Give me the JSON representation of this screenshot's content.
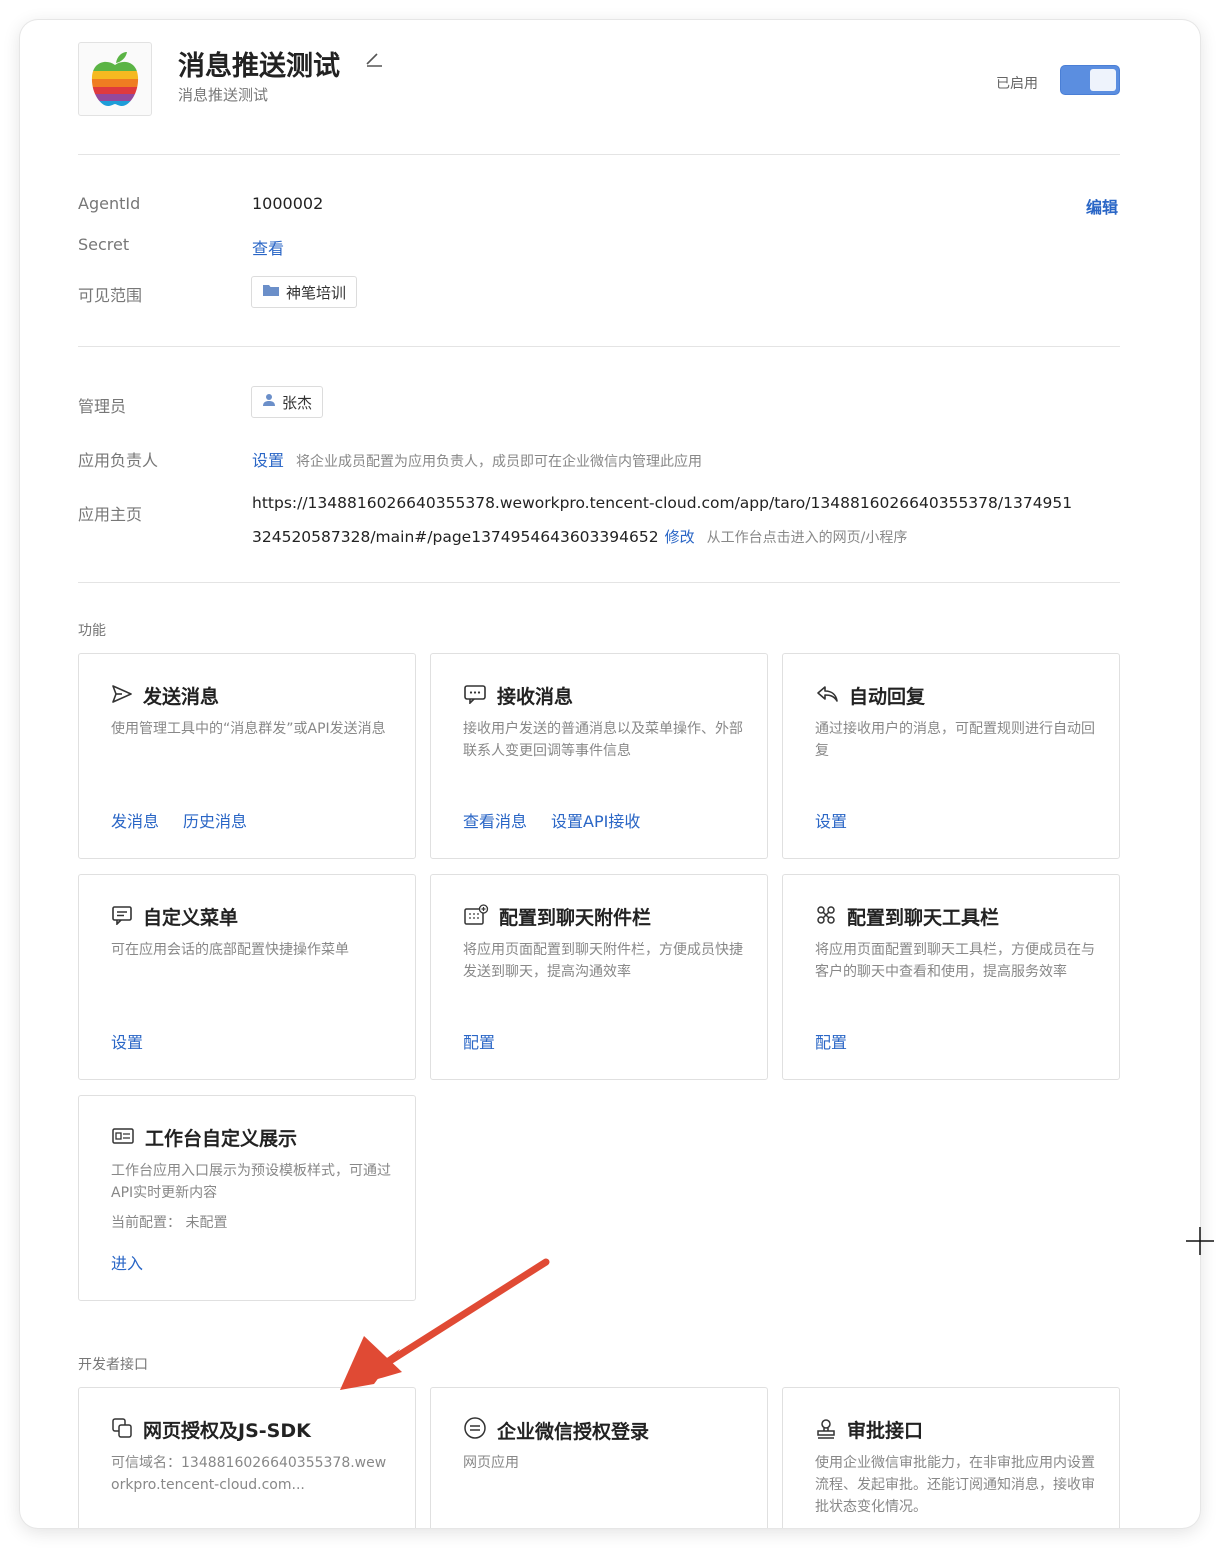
{
  "app": {
    "title": "消息推送测试",
    "subtitle": "消息推送测试",
    "status_label": "已启用",
    "toggle_on": true
  },
  "info": {
    "edit_label": "编辑",
    "agentid_label": "AgentId",
    "agentid_value": "1000002",
    "secret_label": "Secret",
    "secret_action": "查看",
    "scope_label": "可见范围",
    "scope_value": "神笔培训"
  },
  "admin": {
    "admin_label": "管理员",
    "admin_value": "张杰",
    "owner_label": "应用负责人",
    "owner_action": "设置",
    "owner_hint": "将企业成员配置为应用负责人，成员即可在企业微信内管理此应用",
    "homepage_label": "应用主页",
    "homepage_line1": "https://1348816026640355378.weworkpro.tencent-cloud.com/app/taro/1348816026640355378/1374951",
    "homepage_line2": "324520587328/main#/page1374954643603394652",
    "homepage_action": "修改",
    "homepage_hint": "从工作台点击进入的网页/小程序"
  },
  "features": {
    "section_title": "功能",
    "cards": [
      {
        "icon": "send-icon",
        "title": "发送消息",
        "desc": "使用管理工具中的“消息群发”或API发送消息",
        "actions": [
          "发消息",
          "历史消息"
        ]
      },
      {
        "icon": "message-icon",
        "title": "接收消息",
        "desc": "接收用户发送的普通消息以及菜单操作、外部联系人变更回调等事件信息",
        "actions": [
          "查看消息",
          "设置API接收"
        ]
      },
      {
        "icon": "reply-icon",
        "title": "自动回复",
        "desc": "通过接收用户的消息，可配置规则进行自动回复",
        "actions": [
          "设置"
        ]
      },
      {
        "icon": "menu-icon",
        "title": "自定义菜单",
        "desc": "可在应用会话的底部配置快捷操作菜单",
        "actions": [
          "设置"
        ]
      },
      {
        "icon": "attachment-bar-icon",
        "title": "配置到聊天附件栏",
        "desc": "将应用页面配置到聊天附件栏，方便成员快捷发送到聊天，提高沟通效率",
        "actions": [
          "配置"
        ]
      },
      {
        "icon": "toolbar-icon",
        "title": "配置到聊天工具栏",
        "desc": "将应用页面配置到聊天工具栏，方便成员在与客户的聊天中查看和使用，提高服务效率",
        "actions": [
          "配置"
        ]
      },
      {
        "icon": "workbench-icon",
        "title": "工作台自定义展示",
        "desc": "工作台应用入口展示为预设模板样式，可通过API实时更新内容",
        "extra": "当前配置： 未配置",
        "actions": [
          "进入"
        ]
      }
    ]
  },
  "developer": {
    "section_title": "开发者接口",
    "cards": [
      {
        "icon": "web-auth-icon",
        "title": "网页授权及JS-SDK",
        "desc": "可信域名：1348816026640355378.weworkpro.tencent-cloud.com..."
      },
      {
        "icon": "login-icon",
        "title": "企业微信授权登录",
        "desc": "网页应用"
      },
      {
        "icon": "approval-icon",
        "title": "审批接口",
        "desc": "使用企业微信审批能力，在非审批应用内设置流程、发起审批。还能订阅通知消息，接收审批状态变化情况。"
      }
    ]
  },
  "colors": {
    "link": "#2a66c6",
    "toggle": "#5b8ee0",
    "annotation_arrow": "#e04a34"
  }
}
